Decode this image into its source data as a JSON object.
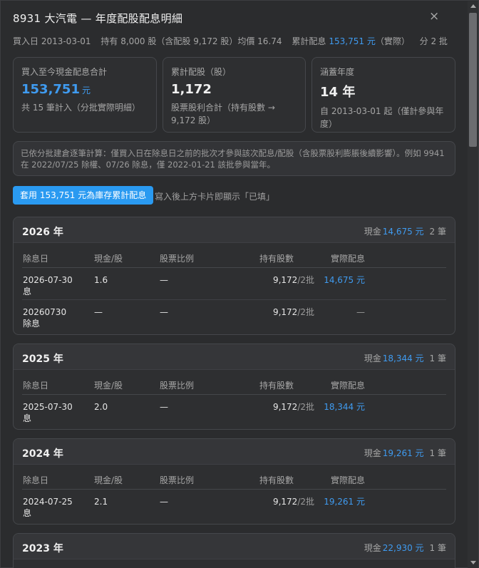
{
  "dialog": {
    "title": "8931 大汽電 — 年度配股配息明細",
    "close_glyph": "×",
    "subline": {
      "buy_date": "買入日 2013-03-01",
      "holding": "持有 8,000 股（含配股 9,172 股）均價 16.74",
      "cumulative_prefix": "累計配息",
      "cumulative_amount": "153,751 元",
      "cumulative_suffix": "（實際）",
      "batches": "分 2 批"
    }
  },
  "cards": [
    {
      "label": "買入至今現金配息合計",
      "value": "153,751",
      "unit": "元",
      "note": "共 15 筆計入（分批實際明細）"
    },
    {
      "label": "累計配股（股）",
      "value": "1,172",
      "note": "股票股利合計（持有股數 → 9,172 股）"
    },
    {
      "label": "涵蓋年度",
      "value": "14 年",
      "note": "自 2013-03-01 起（僅計參與年度）"
    }
  ],
  "notice": "已依分批建倉逐筆計算：僅買入日在除息日之前的批次才參與該次配息/配股（含股票股利膨脹後續影響）。例如 9941 在 2022/07/25 除權、07/26 除息，僅 2022-01-21 該批參與當年。",
  "apply": {
    "button_label": "套用 153,751 元為庫存累計配息",
    "hint": "寫入後上方卡片即顯示「已填」"
  },
  "table_headers": {
    "date": "除息日",
    "cash": "現金/股",
    "ratio": "股票比例",
    "holding": "持有股數",
    "actual": "實際配息"
  },
  "sum_labels": {
    "cash_prefix": "現金"
  },
  "years": [
    {
      "year": "2026 年",
      "cash_total": "14,675 元",
      "count": "2 筆",
      "rows": [
        {
          "date": "2026-07-30 息",
          "cash": "1.6",
          "ratio": "—",
          "shares": "9,172",
          "batches": "/2批",
          "actual": "14,675 元"
        },
        {
          "date": "20260730 除息",
          "cash": "—",
          "ratio": "—",
          "shares": "9,172",
          "batches": "/2批",
          "actual": "—"
        }
      ]
    },
    {
      "year": "2025 年",
      "cash_total": "18,344 元",
      "count": "1 筆",
      "rows": [
        {
          "date": "2025-07-30 息",
          "cash": "2.0",
          "ratio": "—",
          "shares": "9,172",
          "batches": "/2批",
          "actual": "18,344 元"
        }
      ]
    },
    {
      "year": "2024 年",
      "cash_total": "19,261 元",
      "count": "1 筆",
      "rows": [
        {
          "date": "2024-07-25 息",
          "cash": "2.1",
          "ratio": "—",
          "shares": "9,172",
          "batches": "/2批",
          "actual": "19,261 元"
        }
      ]
    },
    {
      "year": "2023 年",
      "cash_total": "22,930 元",
      "count": "1 筆",
      "rows": []
    }
  ]
}
